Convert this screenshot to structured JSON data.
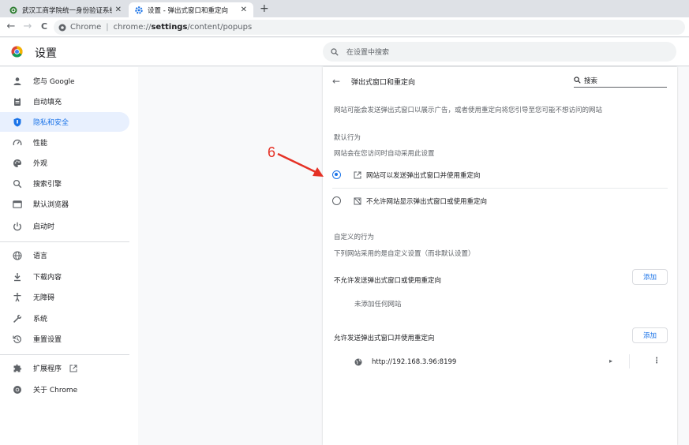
{
  "browser": {
    "tabs": [
      {
        "title": "武汉工商学院统一身份验证系统",
        "close": "✕",
        "icon": "site-favicon"
      },
      {
        "title": "设置 - 弹出式窗口和重定向",
        "close": "✕",
        "icon": "gear-icon"
      }
    ],
    "new_tab": "+",
    "nav": {
      "back": "←",
      "forward": "→",
      "reload": "C"
    },
    "omnibox": {
      "label": "Chrome",
      "separator": "|",
      "url_host": "chrome://",
      "url_path_bold": "settings",
      "url_path_rest": "/content/popups"
    }
  },
  "header": {
    "title": "设置",
    "search_placeholder": "在设置中搜索"
  },
  "sidebar": {
    "items": [
      {
        "label": "您与 Google",
        "icon": "person-icon"
      },
      {
        "label": "自动填充",
        "icon": "clipboard-icon"
      },
      {
        "label": "隐私和安全",
        "icon": "shield-icon"
      },
      {
        "label": "性能",
        "icon": "gauge-icon"
      },
      {
        "label": "外观",
        "icon": "palette-icon"
      },
      {
        "label": "搜索引擎",
        "icon": "search-icon"
      },
      {
        "label": "默认浏览器",
        "icon": "browser-icon"
      },
      {
        "label": "启动时",
        "icon": "power-icon"
      },
      {
        "label": "语言",
        "icon": "globe-icon"
      },
      {
        "label": "下载内容",
        "icon": "download-icon"
      },
      {
        "label": "无障碍",
        "icon": "accessibility-icon"
      },
      {
        "label": "系统",
        "icon": "wrench-icon"
      },
      {
        "label": "重置设置",
        "icon": "reset-icon"
      },
      {
        "label": "扩展程序",
        "icon": "puzzle-icon"
      },
      {
        "label": "关于 Chrome",
        "icon": "chrome-icon"
      }
    ],
    "active_index": 2
  },
  "content": {
    "back": "←",
    "title": "弹出式窗口和重定向",
    "search": "搜索",
    "description": "网站可能会发送弹出式窗口以展示广告，或者使用重定向将您引导至您可能不想访问的网站",
    "default_behavior": {
      "title": "默认行为",
      "subtitle": "网站会在您访问时自动采用此设置",
      "options": [
        {
          "label": "网站可以发送弹出式窗口并使用重定向",
          "selected": true
        },
        {
          "label": "不允许网站显示弹出式窗口或使用重定向",
          "selected": false
        }
      ]
    },
    "custom": {
      "title": "自定义的行为",
      "subtitle": "下列网站采用的是自定义设置（而非默认设置）",
      "block_section": {
        "title": "不允许发送弹出式窗口或使用重定向",
        "add": "添加",
        "empty": "未添加任何网站"
      },
      "allow_section": {
        "title": "允许发送弹出式窗口并使用重定向",
        "add": "添加",
        "sites": [
          {
            "url": "http://192.168.3.96:8199",
            "expand": "▸",
            "more": "⋮"
          }
        ]
      }
    }
  },
  "annotation": {
    "number": "6",
    "color": "#e53125"
  },
  "colors": {
    "accent": "#1a73e8",
    "active_bg": "#e8f0fe"
  }
}
